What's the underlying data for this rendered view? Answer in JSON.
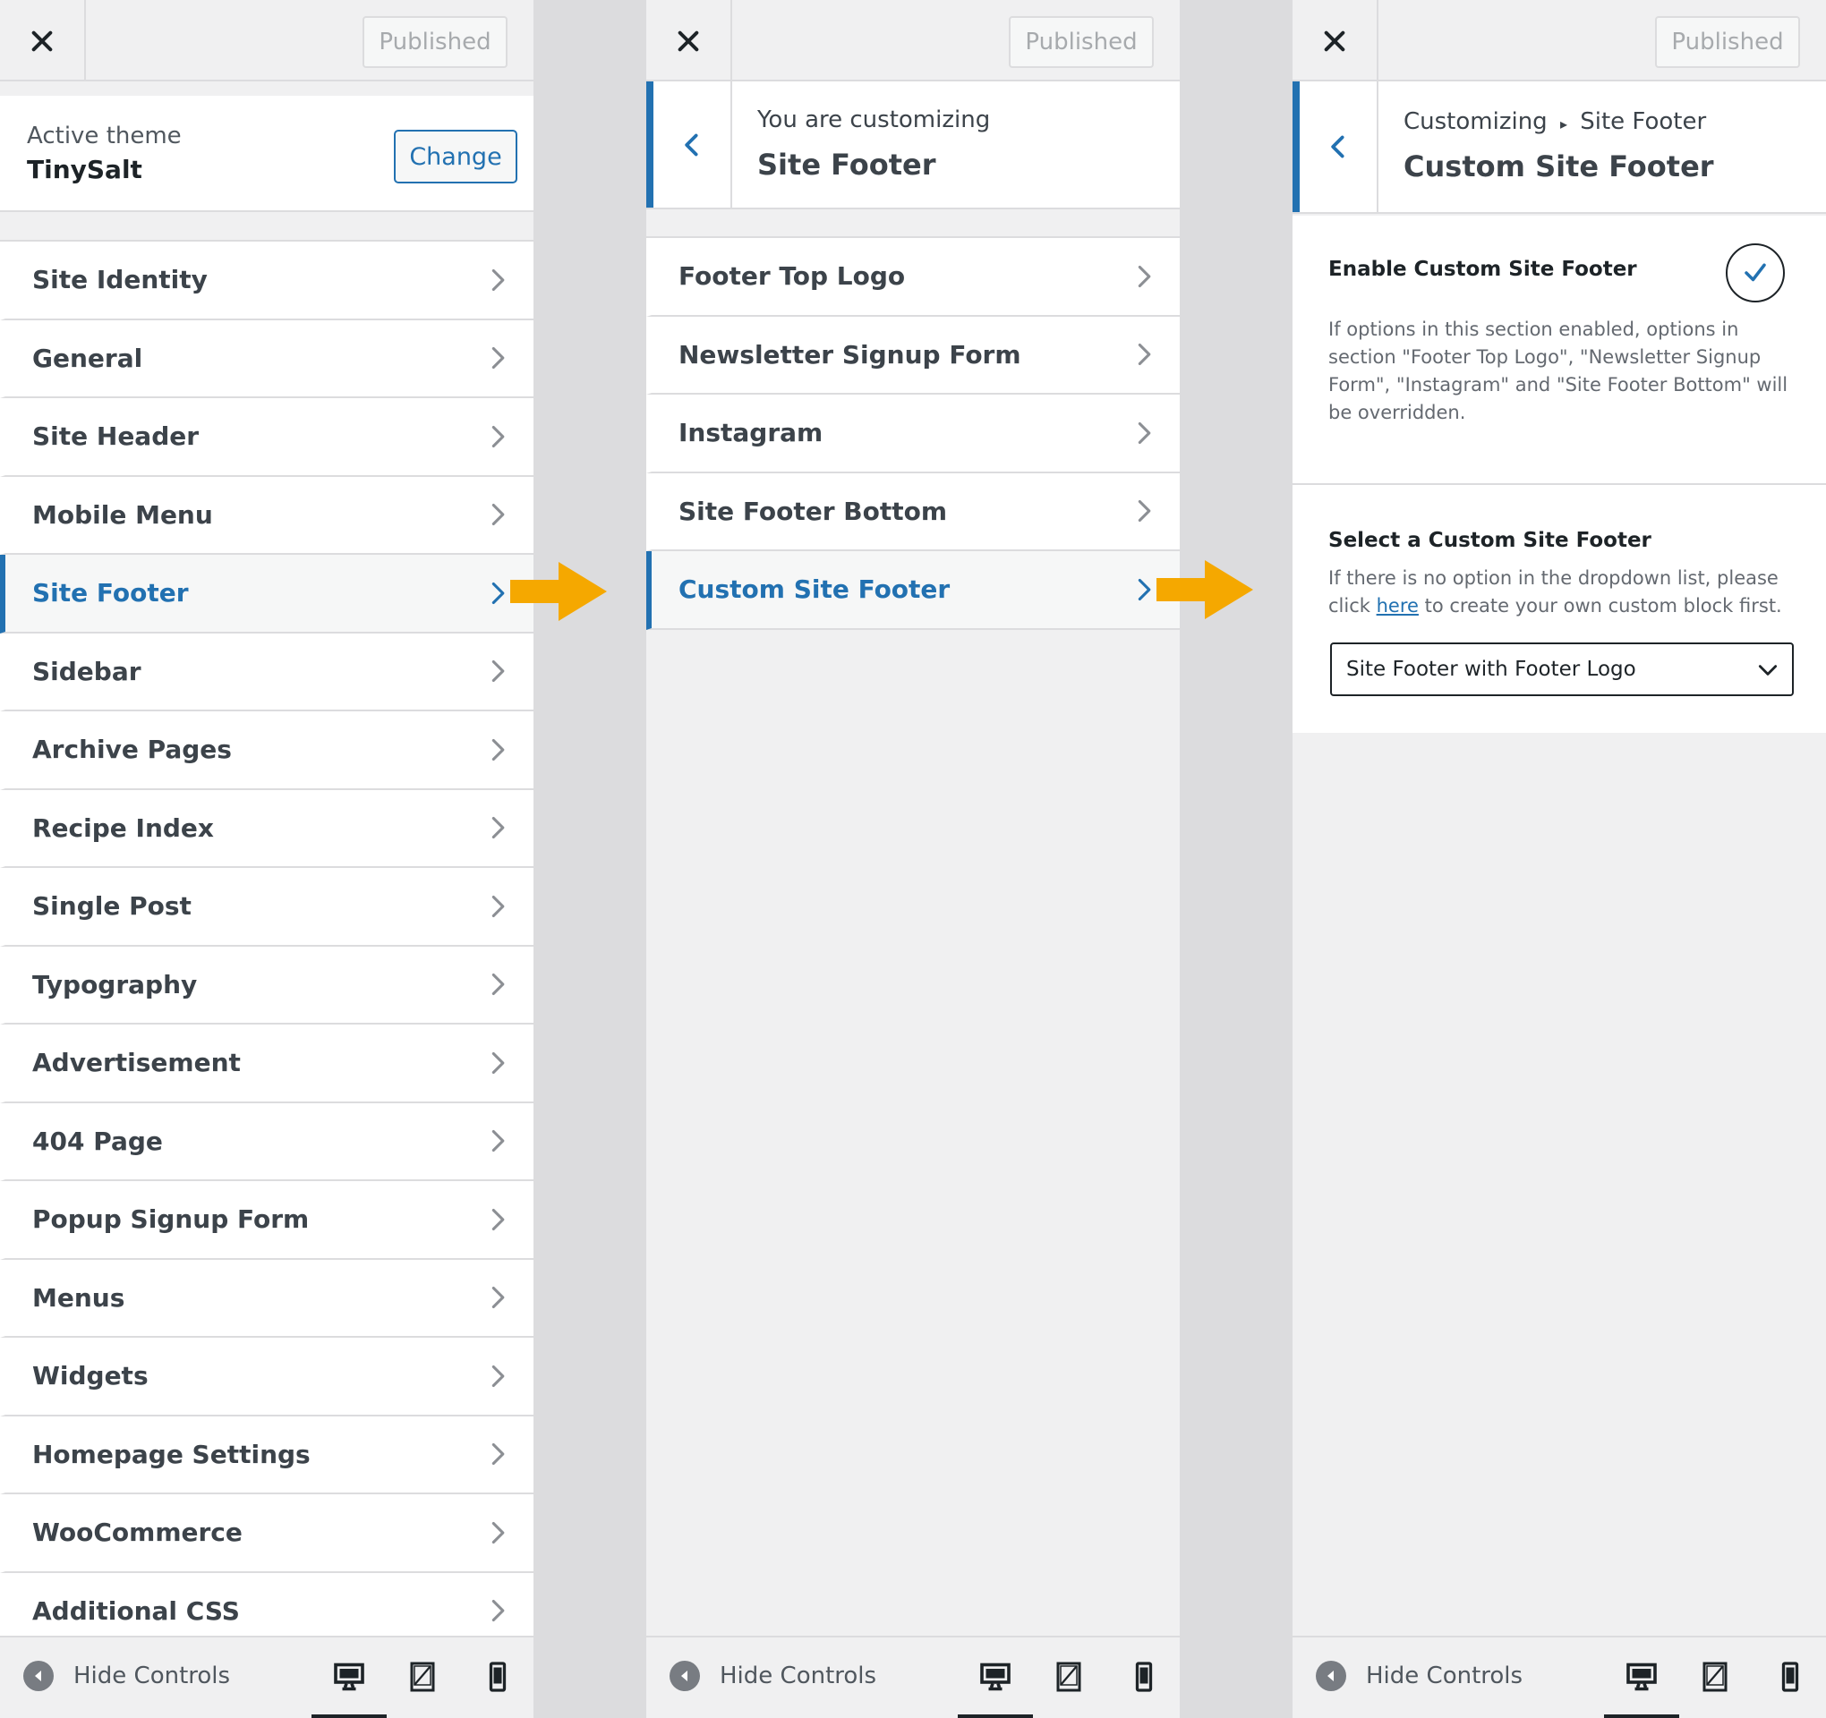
{
  "shared": {
    "published_label": "Published",
    "hide_controls_label": "Hide Controls",
    "icons": {
      "close": "close-icon",
      "chevron": "chevron-right-icon",
      "back": "chevron-left-icon",
      "collapse": "arrow-left-circle-icon",
      "desktop": "desktop-icon",
      "tablet": "tablet-icon",
      "mobile": "mobile-icon"
    },
    "colors": {
      "accent": "#2271b1",
      "arrow": "#f5a800",
      "text": "#3c434a",
      "border": "#dcdcde"
    }
  },
  "panel1": {
    "theme_label": "Active theme",
    "theme_name": "TinySalt",
    "change_label": "Change",
    "items": [
      {
        "label": "Site Identity",
        "active": false
      },
      {
        "label": "General",
        "active": false
      },
      {
        "label": "Site Header",
        "active": false
      },
      {
        "label": "Mobile Menu",
        "active": false
      },
      {
        "label": "Site Footer",
        "active": true
      },
      {
        "label": "Sidebar",
        "active": false
      },
      {
        "label": "Archive Pages",
        "active": false
      },
      {
        "label": "Recipe Index",
        "active": false
      },
      {
        "label": "Single Post",
        "active": false
      },
      {
        "label": "Typography",
        "active": false
      },
      {
        "label": "Advertisement",
        "active": false
      },
      {
        "label": "404 Page",
        "active": false
      },
      {
        "label": "Popup Signup Form",
        "active": false
      },
      {
        "label": "Menus",
        "active": false
      },
      {
        "label": "Widgets",
        "active": false
      },
      {
        "label": "Homepage Settings",
        "active": false
      },
      {
        "label": "WooCommerce",
        "active": false
      },
      {
        "label": "Additional CSS",
        "active": false
      }
    ]
  },
  "panel2": {
    "subtitle": "You are customizing",
    "title": "Site Footer",
    "items": [
      {
        "label": "Footer Top Logo",
        "active": false
      },
      {
        "label": "Newsletter Signup Form",
        "active": false
      },
      {
        "label": "Instagram",
        "active": false
      },
      {
        "label": "Site Footer Bottom",
        "active": false
      },
      {
        "label": "Custom Site Footer",
        "active": true
      }
    ]
  },
  "panel3": {
    "breadcrumb_root": "Customizing",
    "breadcrumb_sep": "▸",
    "breadcrumb_parent": "Site Footer",
    "title": "Custom Site Footer",
    "enable_title": "Enable Custom Site Footer",
    "enable_checked": true,
    "enable_desc": "If options in this section enabled, options in section \"Footer Top Logo\", \"Newsletter Signup Form\", \"Instagram\" and \"Site Footer Bottom\" will be overridden.",
    "select_title": "Select a Custom Site Footer",
    "select_desc_before": "If there is no option in the dropdown list, please click ",
    "select_desc_link": "here",
    "select_desc_after": " to create your own custom block first.",
    "select_value": "Site Footer with Footer Logo"
  }
}
